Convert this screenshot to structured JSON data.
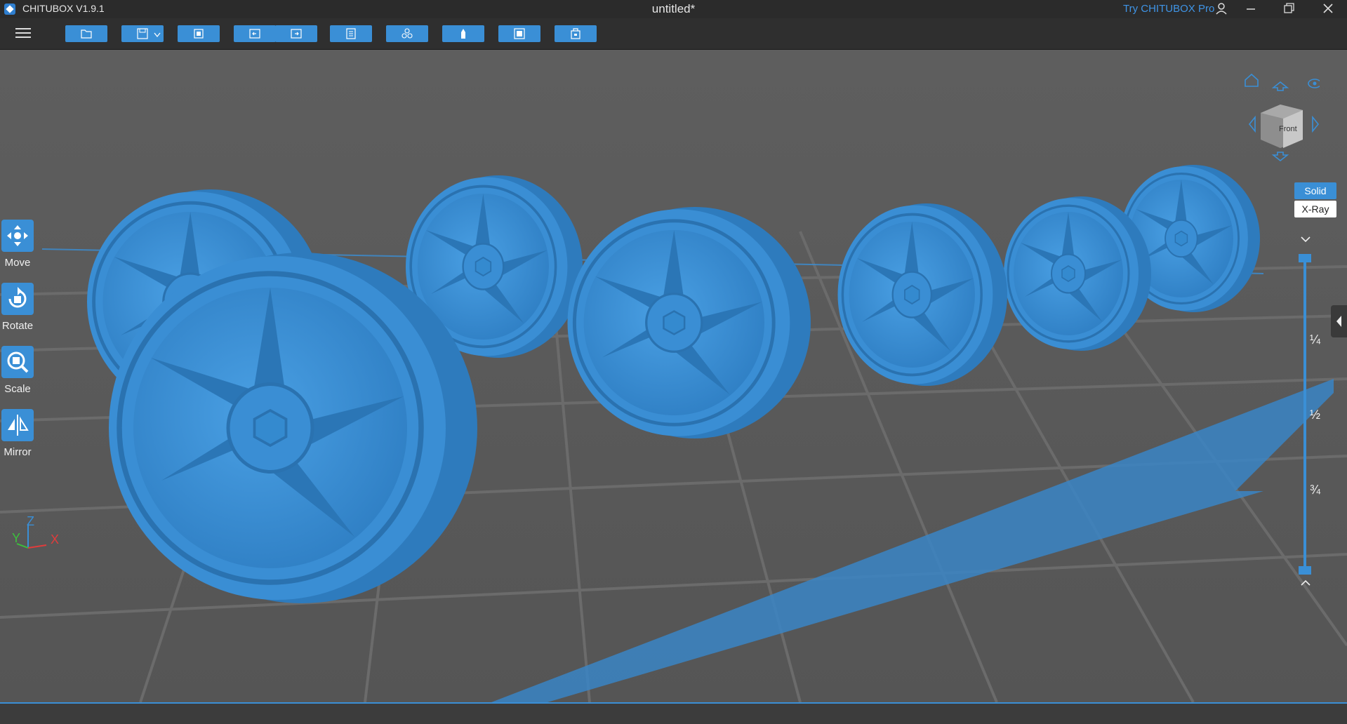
{
  "app": {
    "name": "CHITUBOX V1.9.1",
    "document_title": "untitled*",
    "try_pro": "Try CHITUBOX Pro",
    "accent_color": "#3a8fd6",
    "pro_link_color": "#3f94e6"
  },
  "toolbar": {
    "buttons": [
      {
        "name": "open-file",
        "icon": "folder-icon"
      },
      {
        "name": "save",
        "icon": "save-icon"
      },
      {
        "name": "fit-view",
        "icon": "fit-icon"
      },
      {
        "name": "undo",
        "icon": "undo-icon"
      },
      {
        "name": "redo",
        "icon": "redo-icon"
      },
      {
        "name": "settings",
        "icon": "settings-icon"
      },
      {
        "name": "arrange",
        "icon": "arrange-icon"
      },
      {
        "name": "support",
        "icon": "support-icon"
      },
      {
        "name": "hollow",
        "icon": "hollow-icon"
      },
      {
        "name": "slice",
        "icon": "slice-icon"
      }
    ]
  },
  "side_tools": [
    {
      "label": "Move",
      "icon": "move-icon"
    },
    {
      "label": "Rotate",
      "icon": "rotate-icon"
    },
    {
      "label": "Scale",
      "icon": "scale-icon"
    },
    {
      "label": "Mirror",
      "icon": "mirror-icon"
    }
  ],
  "view": {
    "cube_face": "Front",
    "modes": {
      "solid": "Solid",
      "xray": "X-Ray"
    },
    "active_mode": "Solid",
    "fractions": [
      "¼",
      "½",
      "¾"
    ],
    "axes": {
      "x": "X",
      "y": "Y",
      "z": "Z"
    }
  },
  "scene": {
    "object": "wheel rims",
    "count": 7,
    "model_color": "#3b8fd4"
  }
}
